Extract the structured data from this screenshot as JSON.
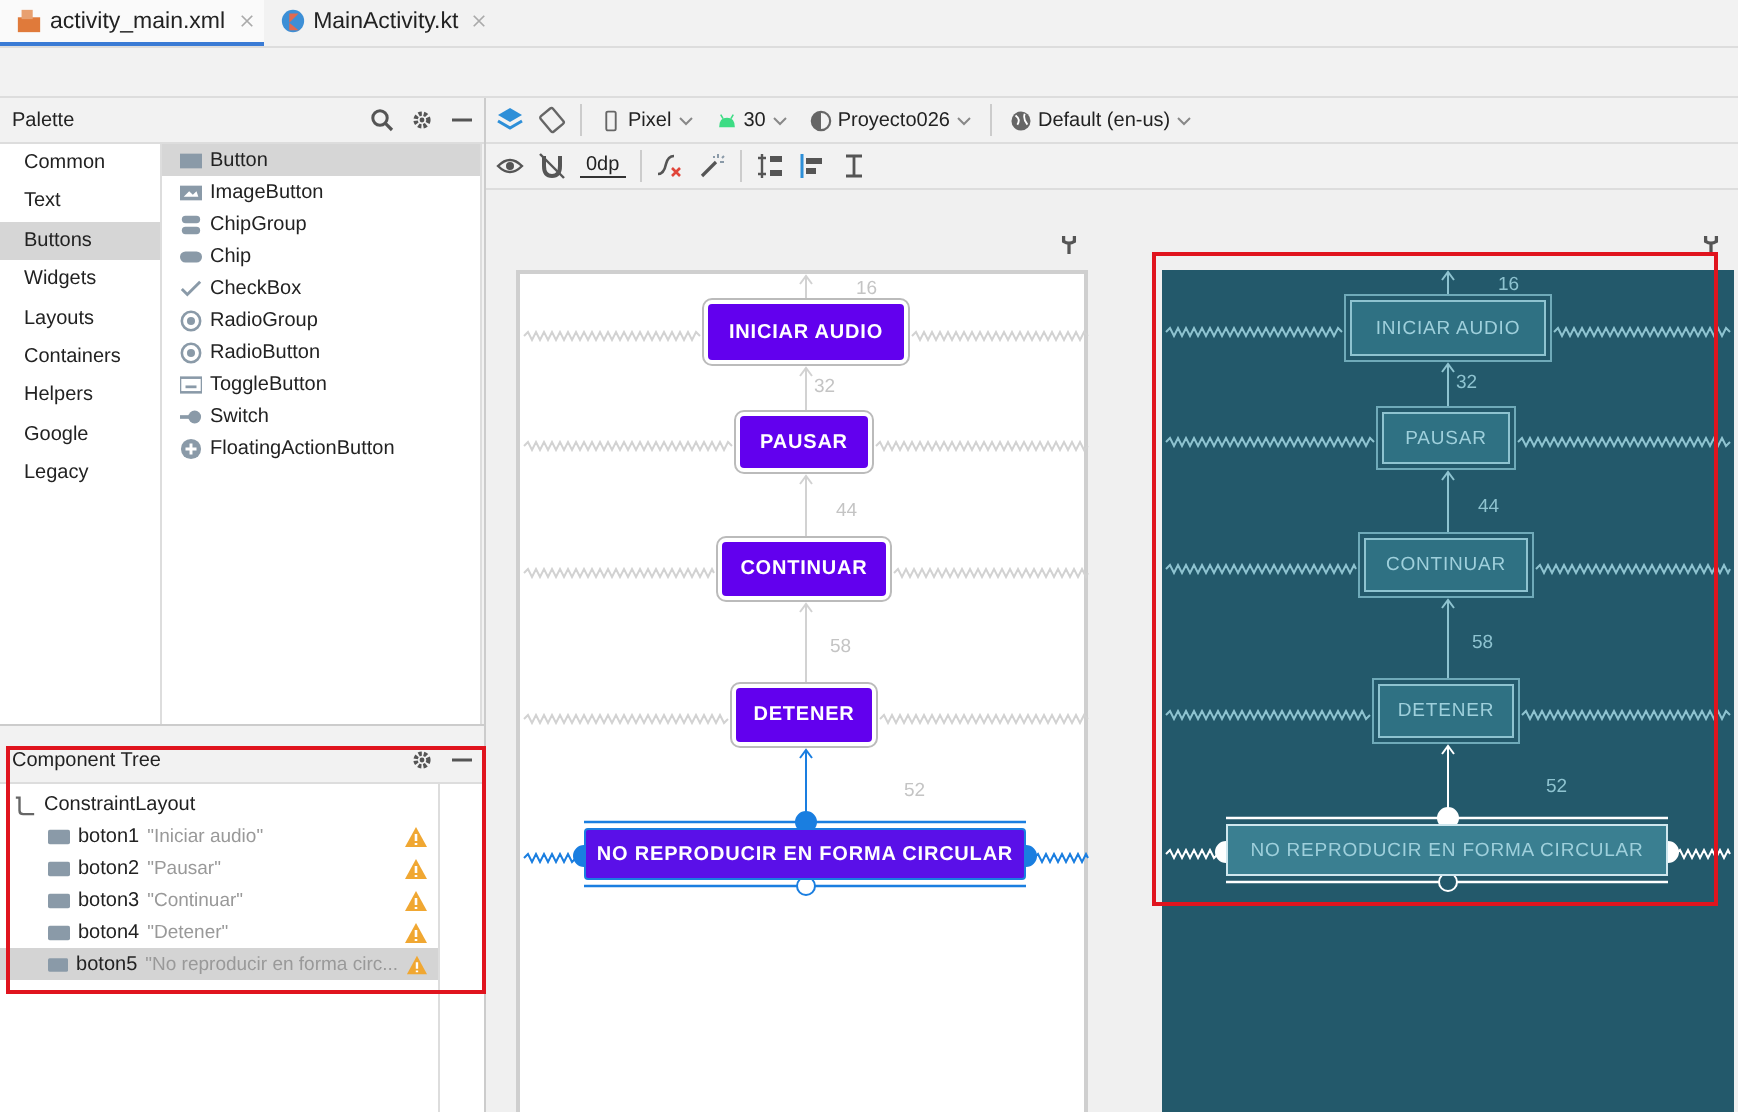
{
  "tabs": [
    {
      "label": "activity_main.xml",
      "selected": true
    },
    {
      "label": "MainActivity.kt",
      "selected": false
    }
  ],
  "palette": {
    "title": "Palette",
    "categories": [
      {
        "label": "Common",
        "selected": false
      },
      {
        "label": "Text",
        "selected": false
      },
      {
        "label": "Buttons",
        "selected": true
      },
      {
        "label": "Widgets",
        "selected": false
      },
      {
        "label": "Layouts",
        "selected": false
      },
      {
        "label": "Containers",
        "selected": false
      },
      {
        "label": "Helpers",
        "selected": false
      },
      {
        "label": "Google",
        "selected": false
      },
      {
        "label": "Legacy",
        "selected": false
      }
    ],
    "items": [
      {
        "label": "Button",
        "selected": true
      },
      {
        "label": "ImageButton",
        "selected": false
      },
      {
        "label": "ChipGroup",
        "selected": false
      },
      {
        "label": "Chip",
        "selected": false
      },
      {
        "label": "CheckBox",
        "selected": false
      },
      {
        "label": "RadioGroup",
        "selected": false
      },
      {
        "label": "RadioButton",
        "selected": false
      },
      {
        "label": "ToggleButton",
        "selected": false
      },
      {
        "label": "Switch",
        "selected": false
      },
      {
        "label": "FloatingActionButton",
        "selected": false
      }
    ]
  },
  "component_tree": {
    "title": "Component Tree",
    "root": {
      "label": "ConstraintLayout",
      "children": [
        {
          "name": "boton1",
          "text": "\"Iniciar audio\"",
          "warning": true,
          "selected": false
        },
        {
          "name": "boton2",
          "text": "\"Pausar\"",
          "warning": true,
          "selected": false
        },
        {
          "name": "boton3",
          "text": "\"Continuar\"",
          "warning": true,
          "selected": false
        },
        {
          "name": "boton4",
          "text": "\"Detener\"",
          "warning": true,
          "selected": false
        },
        {
          "name": "boton5",
          "text": "\"No reproducir en forma circ...",
          "warning": true,
          "selected": true
        }
      ]
    }
  },
  "toolbar": {
    "device": "Pixel",
    "api": "30",
    "theme": "Proyecto026",
    "locale": "Default (en-us)",
    "default_margin": "0dp"
  },
  "design": {
    "buttons": [
      {
        "label": "INICIAR AUDIO",
        "selected": false
      },
      {
        "label": "PAUSAR",
        "selected": false
      },
      {
        "label": "CONTINUAR",
        "selected": false
      },
      {
        "label": "DETENER",
        "selected": false
      },
      {
        "label": "NO REPRODUCIR EN FORMA CIRCULAR",
        "selected": true
      }
    ],
    "margins": [
      "16",
      "32",
      "44",
      "58",
      "52"
    ]
  },
  "blueprint": {
    "buttons": [
      {
        "label": "INICIAR AUDIO",
        "selected": false
      },
      {
        "label": "PAUSAR",
        "selected": false
      },
      {
        "label": "CONTINUAR",
        "selected": false
      },
      {
        "label": "DETENER",
        "selected": false
      },
      {
        "label": "NO REPRODUCIR EN FORMA CIRCULAR",
        "selected": true
      }
    ],
    "margins": [
      "16",
      "32",
      "44",
      "58",
      "52"
    ]
  }
}
